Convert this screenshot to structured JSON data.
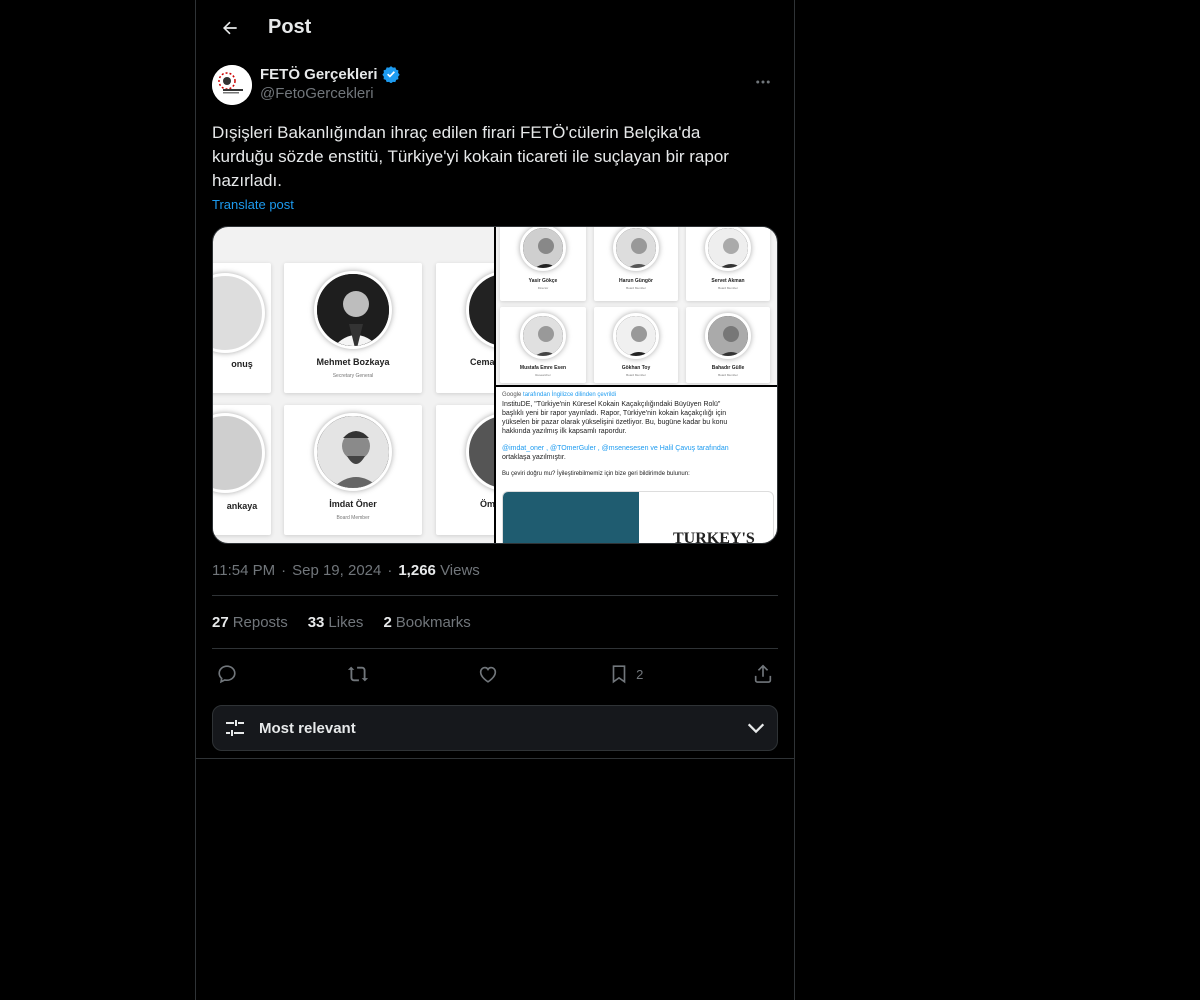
{
  "header": {
    "title": "Post"
  },
  "author": {
    "display_name": "FETÖ Gerçekleri",
    "handle": "@FetoGercekleri",
    "verified": true,
    "avatar_text": "FETÖ GERÇEKLERİ"
  },
  "post": {
    "text": "Dışişleri Bakanlığından ihraç edilen firari FETÖ'cülerin Belçika'da kurduğu sözde enstitü, Türkiye'yi kokain ticareti ile suçlayan bir rapor hazırladı.",
    "translate_label": "Translate post",
    "time": "11:54 PM",
    "date": "Sep 19, 2024",
    "views_count": "1,266",
    "views_label": "Views"
  },
  "media": {
    "left": {
      "cards": [
        {
          "name": "Yunus",
          "name_partial": "onuş",
          "role": ""
        },
        {
          "name": "Mehmet Bozkaya",
          "role": "Secretary General"
        },
        {
          "name": "Cema",
          "role": ""
        },
        {
          "name_partial": "ankaya",
          "role": ""
        },
        {
          "name": "İmdat Öner",
          "role": "Board Member"
        },
        {
          "name": "Öm",
          "role": ""
        }
      ]
    },
    "top_right": {
      "cards": [
        {
          "name": "Yasir Gökçe",
          "role": "Director"
        },
        {
          "name": "Harun Güngör",
          "role": "Board Member"
        },
        {
          "name": "Servet Akman",
          "role": "Board Member"
        },
        {
          "name": "Mustafa Emre Esen",
          "role": "Researcher"
        },
        {
          "name": "Gökhan Toy",
          "role": "Board Member"
        },
        {
          "name": "Bahadır Gülle",
          "role": "Board Member"
        }
      ]
    },
    "bottom_right": {
      "google_label": "Google",
      "translated_label": "tarafından İngilizce dilinden çevrildi",
      "line1": "InstituDE, \"Türkiye'nin Küresel Kokain Kaçakçılığındaki Büyüyen Rolü\"",
      "line2": "başlıklı yeni bir rapor yayınladı. Rapor, Türkiye'nin kokain kaçakçılığı için",
      "line3": "yükselen bir pazar olarak yükselişini özetliyor. Bu, bugüne kadar bu konu",
      "line4": "hakkında yazılmış ilk kapsamlı rapordur.",
      "mentions": "@imdat_oner , @TOmerGuler , @msenesesen ve Halil Çavuş tarafından",
      "mentions_tail": "ortaklaşa yazılmıştır.",
      "feedback": "Bu çeviri doğru mu? İyileştirebilmemiz için bize geri bildirimde bulunun:",
      "cover_text": "TURKEY'S"
    }
  },
  "stats": {
    "reposts_count": "27",
    "reposts_label": "Reposts",
    "likes_count": "33",
    "likes_label": "Likes",
    "bookmarks_count": "2",
    "bookmarks_label": "Bookmarks"
  },
  "actions": {
    "bookmark_count": "2"
  },
  "sort": {
    "label": "Most relevant"
  },
  "colors": {
    "accent": "#1d9bf0",
    "background": "#000000",
    "border": "#2f3336",
    "muted": "#71767b"
  }
}
